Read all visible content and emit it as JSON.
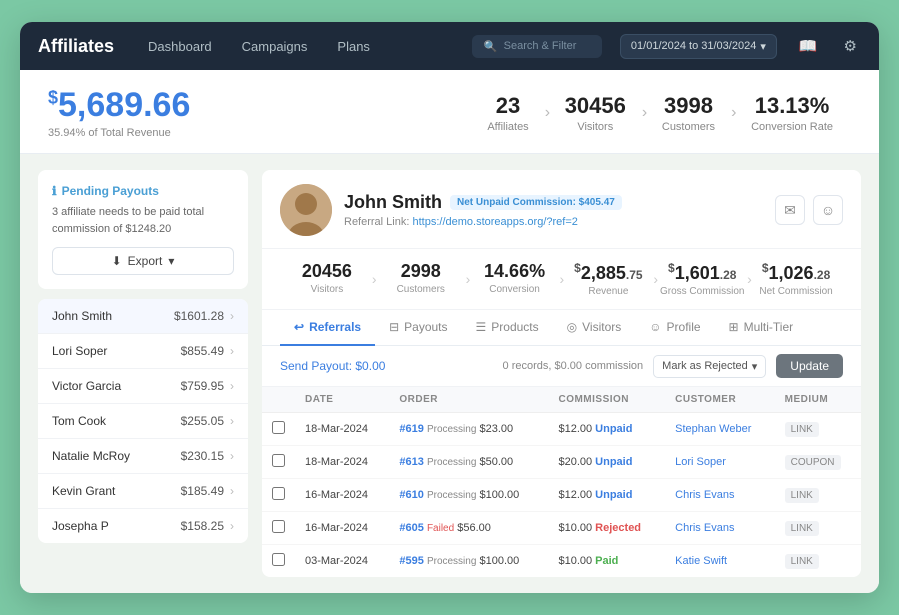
{
  "app": {
    "title": "Affiliates",
    "nav": {
      "links": [
        "Dashboard",
        "Campaigns",
        "Plans"
      ]
    },
    "search_placeholder": "Search & Filter",
    "date_range": "01/01/2024  to  31/03/2024"
  },
  "stats_bar": {
    "main_value": "5,689.66",
    "main_currency": "$",
    "main_sub": "35.94% of Total Revenue",
    "items": [
      {
        "value": "23",
        "label": "Affiliates"
      },
      {
        "value": "30456",
        "label": "Visitors"
      },
      {
        "value": "3998",
        "label": "Customers"
      },
      {
        "value": "13.13%",
        "label": "Conversion Rate"
      }
    ]
  },
  "sidebar": {
    "pending_title": "Pending Payouts",
    "pending_desc": "3 affiliate needs to be paid total commission of $1248.20",
    "export_label": "Export",
    "affiliates": [
      {
        "name": "John Smith",
        "amount": "$1601.28",
        "active": true
      },
      {
        "name": "Lori Soper",
        "amount": "$855.49"
      },
      {
        "name": "Victor Garcia",
        "amount": "$759.95"
      },
      {
        "name": "Tom Cook",
        "amount": "$255.05"
      },
      {
        "name": "Natalie McRoy",
        "amount": "$230.15"
      },
      {
        "name": "Kevin Grant",
        "amount": "$185.49"
      },
      {
        "name": "Josepha P",
        "amount": "$158.25"
      }
    ]
  },
  "affiliate_detail": {
    "name": "John Smith",
    "unpaid_badge": "Net Unpaid Commission: $405.47",
    "referral_label": "Referral Link:",
    "referral_url": "https://demo.storeapps.org/?ref=2",
    "stats": [
      {
        "value": "20456",
        "label": "Visitors",
        "currency": false
      },
      {
        "value": "2998",
        "label": "Customers",
        "currency": false
      },
      {
        "value": "14.66%",
        "label": "Conversion",
        "currency": false
      },
      {
        "int": "2,885",
        "dec": "75",
        "label": "Revenue",
        "currency": true,
        "sign": "$"
      },
      {
        "int": "1,601",
        "dec": "28",
        "label": "Gross Commission",
        "currency": true,
        "sign": "$"
      },
      {
        "int": "1,026",
        "dec": "28",
        "label": "Net Commission",
        "currency": true,
        "sign": "$"
      }
    ],
    "tabs": [
      {
        "id": "referrals",
        "label": "Referrals",
        "icon": "↩",
        "active": true
      },
      {
        "id": "payouts",
        "label": "Payouts",
        "icon": "⊟"
      },
      {
        "id": "products",
        "label": "Products",
        "icon": "☰"
      },
      {
        "id": "visitors",
        "label": "Visitors",
        "icon": "◎"
      },
      {
        "id": "profile",
        "label": "Profile",
        "icon": "☺"
      },
      {
        "id": "multitier",
        "label": "Multi-Tier",
        "icon": "⊞"
      }
    ],
    "toolbar": {
      "send_payout": "Send Payout: $0.00",
      "records_info": "0 records, $0.00 commission",
      "mark_select": "Mark as Rejected",
      "update_btn": "Update"
    },
    "table": {
      "headers": [
        "",
        "DATE",
        "ORDER",
        "COMMISSION",
        "CUSTOMER",
        "MEDIUM"
      ],
      "rows": [
        {
          "date": "18-Mar-2024",
          "order": "#619",
          "status": "Processing",
          "order_amount": "$23.00",
          "commission": "$12.00",
          "commission_status": "Unpaid",
          "customer": "Stephan Weber",
          "medium": "LINK"
        },
        {
          "date": "18-Mar-2024",
          "order": "#613",
          "status": "Processing",
          "order_amount": "$50.00",
          "commission": "$20.00",
          "commission_status": "Unpaid",
          "customer": "Lori Soper",
          "medium": "COUPON"
        },
        {
          "date": "16-Mar-2024",
          "order": "#610",
          "status": "Processing",
          "order_amount": "$100.00",
          "commission": "$12.00",
          "commission_status": "Unpaid",
          "customer": "Chris Evans",
          "medium": "LINK"
        },
        {
          "date": "16-Mar-2024",
          "order": "#605",
          "status": "Failed",
          "order_amount": "$56.00",
          "commission": "$10.00",
          "commission_status": "Rejected",
          "customer": "Chris Evans",
          "medium": "LINK"
        },
        {
          "date": "03-Mar-2024",
          "order": "#595",
          "status": "Processing",
          "order_amount": "$100.00",
          "commission": "$10.00",
          "commission_status": "Paid",
          "customer": "Katie Swift",
          "medium": "LINK"
        }
      ]
    }
  }
}
